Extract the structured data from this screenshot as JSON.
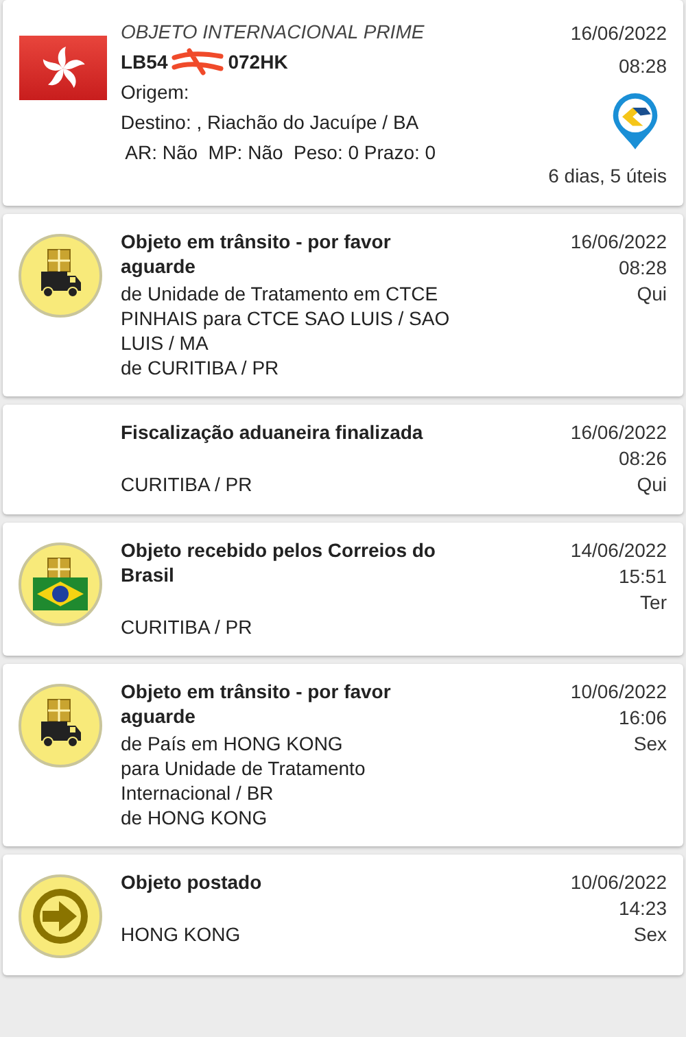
{
  "header": {
    "service": "OBJETO INTERNACIONAL PRIME",
    "code_parts": [
      "LB54",
      "072HK"
    ],
    "origin": "Origem:",
    "destination": "Destino:  , Riachão do Jacuípe / BA",
    "details": " AR: Não  MP: Não  Peso: 0 Prazo: 0",
    "date": "16/06/2022",
    "time": "08:28",
    "duration": "6 dias, 5 úteis"
  },
  "events": [
    {
      "kind": "truck",
      "title": "Objeto em trânsito - por favor aguarde",
      "details": [
        "de Unidade de Tratamento em CTCE PINHAIS para CTCE SAO LUIS / SAO LUIS / MA"
      ],
      "location": "de CURITIBA / PR",
      "date": "16/06/2022",
      "time": "08:28",
      "weekday": "Qui"
    },
    {
      "kind": "none",
      "title": "Fiscalização aduaneira finalizada",
      "location": "CURITIBA / PR",
      "date": "16/06/2022",
      "time": "08:26",
      "weekday": "Qui"
    },
    {
      "kind": "received",
      "title": "Objeto recebido pelos Correios do Brasil",
      "location": "CURITIBA / PR",
      "date": "14/06/2022",
      "time": "15:51",
      "weekday": "Ter"
    },
    {
      "kind": "truck",
      "title": "Objeto em trânsito - por favor aguarde",
      "details": [
        "de País em HONG KONG",
        "para Unidade de Tratamento Internacional / BR"
      ],
      "location": "de HONG KONG",
      "date": "10/06/2022",
      "time": "16:06",
      "weekday": "Sex"
    },
    {
      "kind": "posted",
      "title": "Objeto postado",
      "location": "HONG KONG",
      "date": "10/06/2022",
      "time": "14:23",
      "weekday": "Sex"
    }
  ]
}
